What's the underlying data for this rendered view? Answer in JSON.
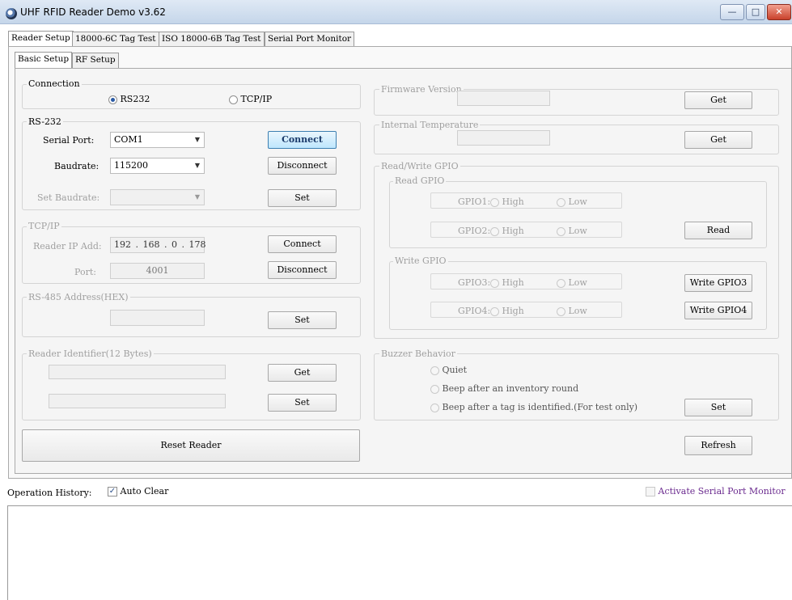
{
  "window": {
    "title": "UHF RFID Reader Demo v3.62",
    "minimize_icon": "minimize-icon",
    "maximize_icon": "maximize-icon",
    "close_icon": "close-icon"
  },
  "main_tabs": [
    "Reader Setup",
    "18000-6C Tag Test",
    "ISO 18000-6B Tag Test",
    "Serial Port Monitor"
  ],
  "sub_tabs": [
    "Basic Setup",
    "RF Setup"
  ],
  "connection": {
    "label": "Connection",
    "rs232": "RS232",
    "tcpip": "TCP/IP",
    "selected": "RS232"
  },
  "rs232": {
    "label": "RS-232",
    "serial_port_label": "Serial Port:",
    "serial_port_value": "COM1",
    "baudrate_label": "Baudrate:",
    "baudrate_value": "115200",
    "set_baudrate_label": "Set Baudrate:",
    "set_baudrate_value": "",
    "connect": "Connect",
    "disconnect": "Disconnect",
    "set": "Set"
  },
  "tcpip": {
    "label": "TCP/IP",
    "ip_label": "Reader IP Add:",
    "ip": [
      "192",
      "168",
      "0",
      "178"
    ],
    "port_label": "Port:",
    "port_value": "4001",
    "connect": "Connect",
    "disconnect": "Disconnect"
  },
  "rs485": {
    "label": "RS-485 Address(HEX)",
    "value": "",
    "set": "Set"
  },
  "reader_identifier": {
    "label": "Reader Identifier(12 Bytes)",
    "get": "Get",
    "set": "Set"
  },
  "reset_reader": "Reset Reader",
  "firmware": {
    "label": "Firmware Version",
    "value": "",
    "get": "Get"
  },
  "temperature": {
    "label": "Internal Temperature",
    "value": "",
    "get": "Get"
  },
  "gpio": {
    "label": "Read/Write GPIO",
    "read_label": "Read GPIO",
    "write_label": "Write GPIO",
    "high": "High",
    "low": "Low",
    "gpio1": "GPIO1:",
    "gpio2": "GPIO2:",
    "gpio3": "GPIO3:",
    "gpio4": "GPIO4:",
    "read": "Read",
    "write3": "Write GPIO3",
    "write4": "Write GPIO4"
  },
  "buzzer": {
    "label": "Buzzer Behavior",
    "quiet": "Quiet",
    "beep_round": "Beep after an inventory round",
    "beep_tag": "Beep after a tag is identified.(For test only)",
    "set": "Set"
  },
  "refresh": "Refresh",
  "history": {
    "label": "Operation History:",
    "auto_clear": "Auto Clear",
    "auto_clear_checked": true,
    "activate_monitor": "Activate Serial Port Monitor",
    "activate_checked": false
  },
  "colors": {
    "accent": "#3c7fb1",
    "monitor_text": "#6b2b8f"
  }
}
